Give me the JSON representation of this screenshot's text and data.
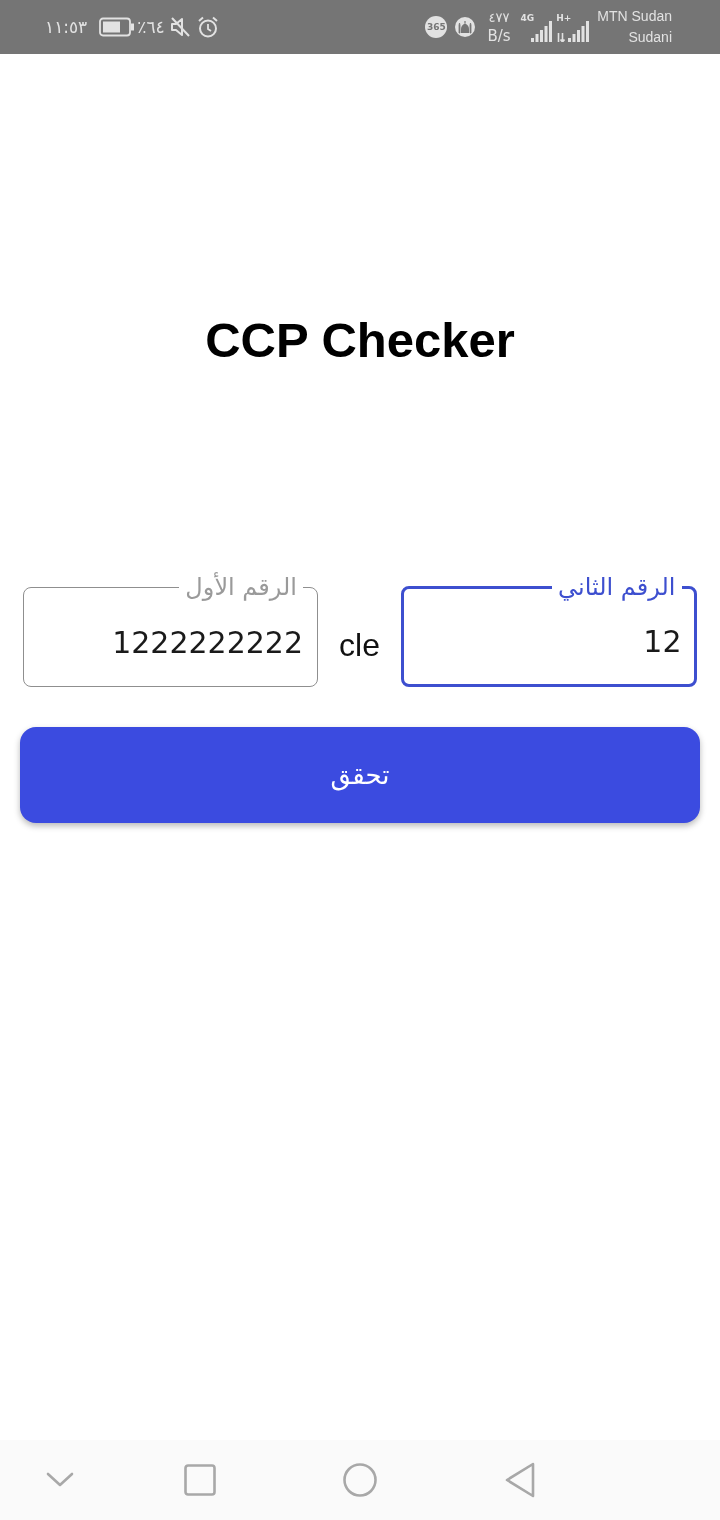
{
  "status_bar": {
    "time": "١١:٥٣",
    "battery": "٪٦٤",
    "app_badge": "365",
    "network_speed": {
      "value": "٤٧٧",
      "unit": "B/s"
    },
    "signals": [
      {
        "network": "H+",
        "data_active": true
      },
      {
        "network": "4G",
        "data_active": false
      }
    ],
    "carriers": [
      "MTN Sudan",
      "Sudani"
    ]
  },
  "title": "CCP Checker",
  "fields": [
    {
      "label": "الرقم الثاني",
      "value": "12",
      "focused": true
    },
    {
      "label": "الرقم الأول",
      "value": "1222222222",
      "focused": false
    }
  ],
  "separator": "cle",
  "button": {
    "label": "تحقق"
  }
}
